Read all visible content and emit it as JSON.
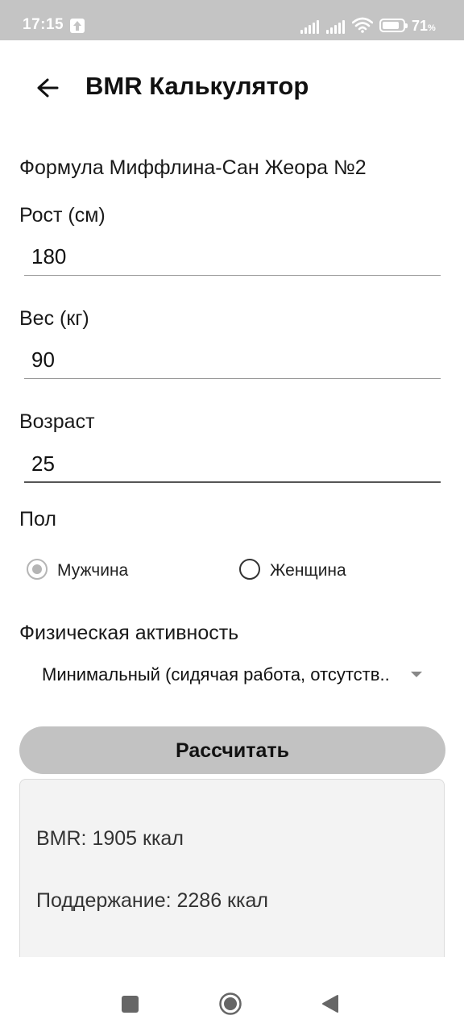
{
  "status_bar": {
    "time": "17:15",
    "battery_value": "71",
    "battery_unit": "%",
    "icons": [
      "upload-icon",
      "signal-icon",
      "signal-icon",
      "wifi-icon",
      "battery-icon"
    ]
  },
  "app_bar": {
    "back_icon": "arrow-left-icon",
    "title": "BMR Калькулятор"
  },
  "form": {
    "formula": "Формула Миффлина-Сан Жеора №2",
    "height_label": "Рост (см)",
    "height_value": "180",
    "weight_label": "Вес (кг)",
    "weight_value": "90",
    "age_label": "Возраст",
    "age_value": "25",
    "gender_label": "Пол",
    "gender_options": [
      {
        "label": "Мужчина",
        "selected": true
      },
      {
        "label": "Женщина",
        "selected": false
      }
    ],
    "activity_label": "Физическая активность",
    "activity_value": "Минимальный (сидячая работа, отсутств..",
    "calculate_label": "Рассчитать"
  },
  "results": {
    "bmr": "BMR: 1905 ккал",
    "maintenance": "Поддержание: 2286 ккал"
  },
  "nav_bar": {
    "icons": [
      "recents-square-icon",
      "home-circle-icon",
      "back-triangle-icon"
    ]
  },
  "colors": {
    "status_bar_bg": "#c4c4c4",
    "button_bg": "#c2c2c2",
    "result_bg": "#f3f3f3"
  }
}
